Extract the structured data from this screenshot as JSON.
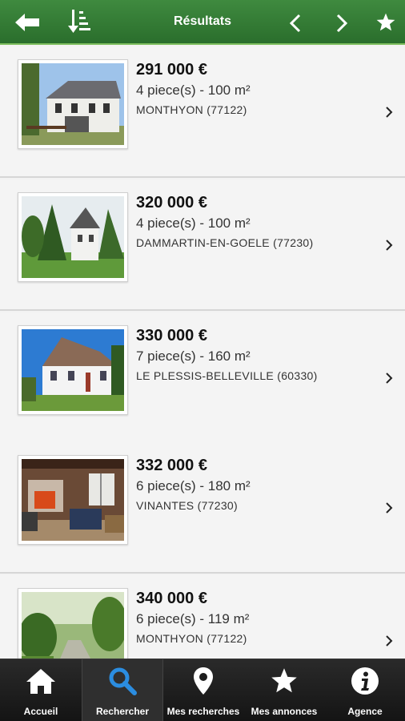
{
  "header": {
    "title": "Résultats",
    "icons": [
      "back-arrow-icon",
      "sort-icon",
      "chevron-left-icon",
      "chevron-right-icon",
      "star-icon"
    ]
  },
  "results": [
    {
      "price": "291 000 €",
      "rooms": "4 piece(s) - 100 m²",
      "city": "MONTHYON (77122)",
      "photo": "house-white-two-storey"
    },
    {
      "price": "320 000 €",
      "rooms": "4 piece(s) - 100 m²",
      "city": "DAMMARTIN-EN-GOELE (77230)",
      "photo": "house-garden-trees"
    },
    {
      "price": "330 000 €",
      "rooms": "7 piece(s) - 160 m²",
      "city": "LE PLESSIS-BELLEVILLE (60330)",
      "photo": "house-white-roof"
    },
    {
      "price": "332 000 €",
      "rooms": "6 piece(s) - 180 m²",
      "city": "VINANTES (77230)",
      "photo": "living-room-fireplace"
    },
    {
      "price": "340 000 €",
      "rooms": "6 piece(s) - 119 m²",
      "city": "MONTHYON (77122)",
      "photo": "garden-path"
    }
  ],
  "bottom_nav": [
    {
      "label": "Accueil",
      "icon": "home-icon",
      "active": false
    },
    {
      "label": "Rechercher",
      "icon": "search-icon",
      "active": true
    },
    {
      "label": "Mes recherches",
      "icon": "map-pin-icon",
      "active": false
    },
    {
      "label": "Mes annonces",
      "icon": "star-icon",
      "active": false
    },
    {
      "label": "Agence",
      "icon": "info-icon",
      "active": false
    }
  ],
  "colors": {
    "header_green": "#2f7a31",
    "active_icon": "#2b8de0",
    "bottom_bar": "#1c1c1c"
  }
}
